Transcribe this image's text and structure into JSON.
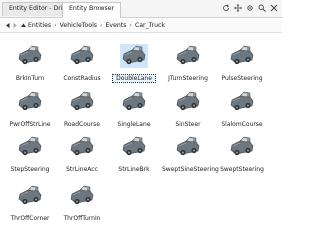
{
  "tabs": [
    {
      "label": "Entity Editor - Driver"
    },
    {
      "label": "Entity Browser"
    }
  ],
  "breadcrumb": [
    "Entities",
    "VehicleTools",
    "Events",
    "Car_Truck"
  ],
  "toolbar_icons": [
    "refresh-icon",
    "move-icon",
    "settings-icon",
    "search-icon",
    "close-icon"
  ],
  "items": [
    {
      "label": "BrkInTurn"
    },
    {
      "label": "ConstRadius"
    },
    {
      "label": "DoubleLane"
    },
    {
      "label": "JTurnSteering"
    },
    {
      "label": "PulseSteering"
    },
    {
      "label": "PwrOffStrLine"
    },
    {
      "label": "RoadCourse"
    },
    {
      "label": "SingleLane"
    },
    {
      "label": "SinSteer"
    },
    {
      "label": "SlalomCourse"
    },
    {
      "label": "StepSteering"
    },
    {
      "label": "StrLineAcc"
    },
    {
      "label": "StrLineBrk"
    },
    {
      "label": "SweptSineSteering"
    },
    {
      "label": "SweptSteering"
    },
    {
      "label": "ThrOffCorner"
    },
    {
      "label": "ThrOffTurnIn"
    }
  ],
  "selected_item": "DoubleLane"
}
